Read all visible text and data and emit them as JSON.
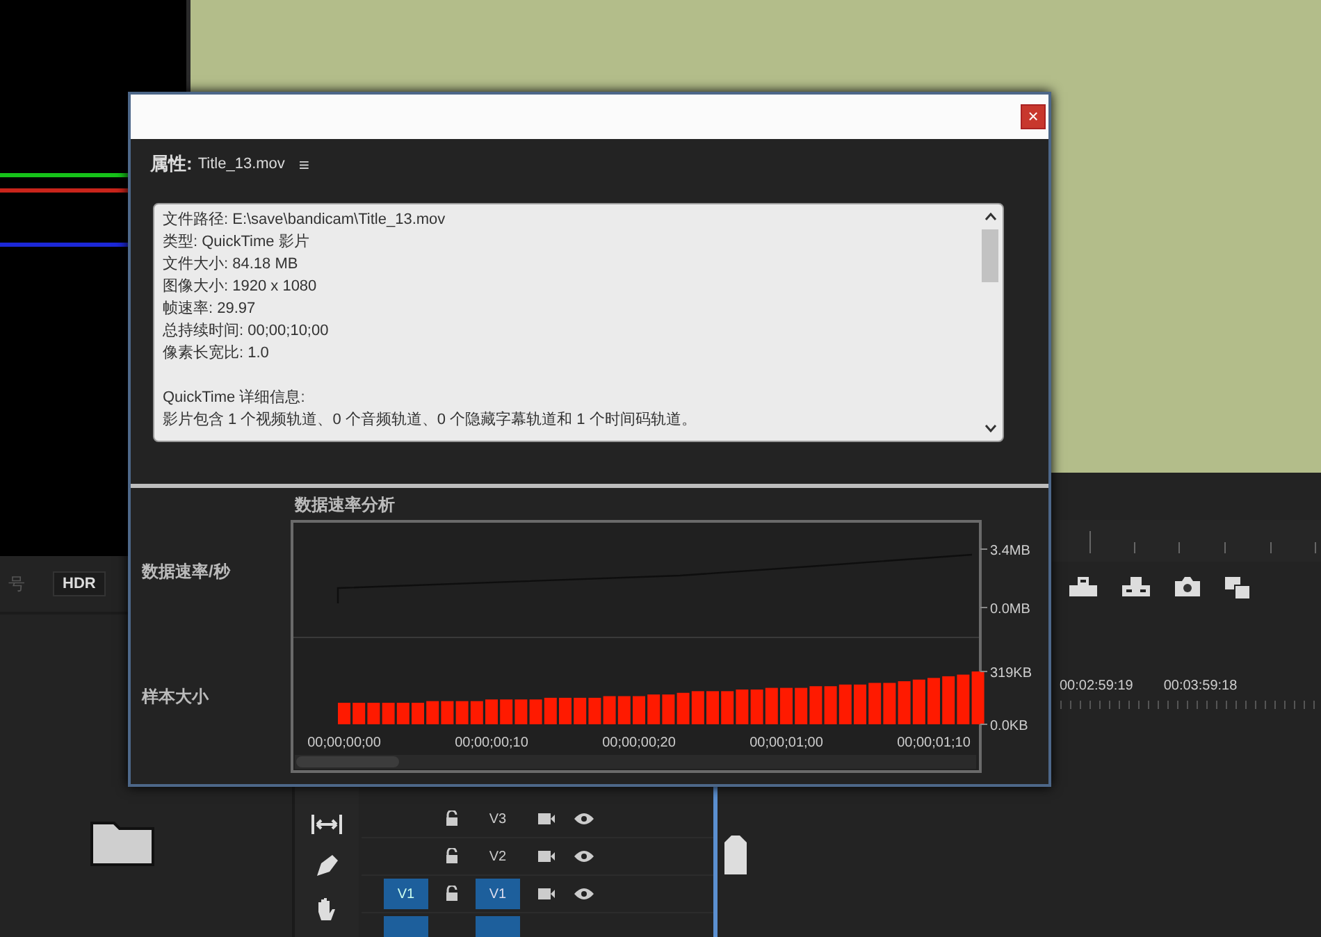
{
  "left_panel": {
    "signal_label": "号",
    "hdr_button": "HDR"
  },
  "timeline": {
    "timecodes": [
      "00:02:59:19",
      "00:03:59:18"
    ],
    "tracks": [
      {
        "label": "V3",
        "targeted": false
      },
      {
        "label": "V2",
        "targeted": false
      },
      {
        "label": "V1",
        "targeted": true,
        "source_patch": "V1"
      }
    ]
  },
  "dialog": {
    "close": "×",
    "title_label": "属性:",
    "file_name": "Title_13.mov",
    "menu": "≡",
    "info_lines": [
      "文件路径: E:\\save\\bandicam\\Title_13.mov",
      "类型: QuickTime 影片",
      "文件大小: 84.18 MB",
      "图像大小: 1920 x 1080",
      "帧速率: 29.97",
      "总持续时间: 00;00;10;00",
      "像素长宽比: 1.0"
    ],
    "details_title": "QuickTime 详细信息:",
    "details_text": "影片包含 1 个视频轨道、0 个音频轨道、0 个隐藏字幕轨道和 1 个时间码轨道。",
    "analysis_title": "数据速率分析",
    "rate_label": "数据速率/秒",
    "sample_label": "样本大小",
    "rate_ticks": [
      "3.4MB",
      "0.0MB"
    ],
    "sample_chart": {
      "chart_data": {
        "type": "bar",
        "ylim": [
          0,
          319
        ],
        "yticks": [
          {
            "value": 0,
            "label": "0.0KB"
          },
          {
            "value": 319,
            "label": "319KB"
          }
        ],
        "categories": [
          "00;00;00;00",
          null,
          null,
          null,
          null,
          null,
          null,
          null,
          null,
          null,
          "00;00;00;10",
          null,
          null,
          null,
          null,
          null,
          null,
          null,
          null,
          null,
          "00;00;00;20",
          null,
          null,
          null,
          null,
          null,
          null,
          null,
          null,
          null,
          "00;00;01;00",
          null,
          null,
          null,
          null,
          null,
          null,
          null,
          null,
          null,
          "00;00;01;10",
          null,
          null,
          null
        ],
        "series": [
          {
            "color": "#ff1a00",
            "values": [
              130,
              130,
              130,
              130,
              130,
              130,
              140,
              140,
              140,
              140,
              150,
              150,
              150,
              150,
              160,
              160,
              160,
              160,
              170,
              170,
              170,
              180,
              180,
              190,
              200,
              200,
              200,
              210,
              210,
              220,
              220,
              220,
              230,
              230,
              240,
              240,
              250,
              250,
              260,
              270,
              280,
              290,
              300,
              319
            ]
          }
        ]
      }
    }
  }
}
